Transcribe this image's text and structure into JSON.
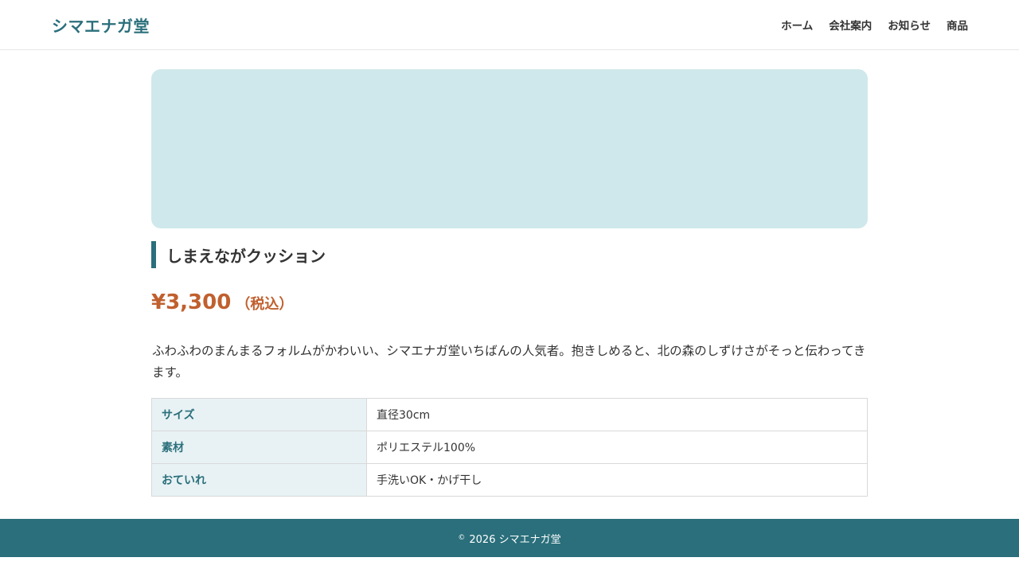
{
  "header": {
    "logo": "シマエナガ堂",
    "nav": [
      {
        "label": "ホーム"
      },
      {
        "label": "会社案内"
      },
      {
        "label": "お知らせ"
      },
      {
        "label": "商品"
      }
    ]
  },
  "product": {
    "name": "しまえながクッション",
    "price": "¥3,300",
    "tax_note": "（税込）",
    "description": "ふわふわのまんまるフォルムがかわいい、シマエナガ堂いちばんの人気者。抱きしめると、北の森のしずけさがそっと伝わってきます。",
    "specs": [
      {
        "label": "サイズ",
        "value": "直径30cm"
      },
      {
        "label": "素材",
        "value": "ポリエステル100%"
      },
      {
        "label": "おていれ",
        "value": "手洗いOK・かげ干し"
      }
    ]
  },
  "footer": {
    "copyright_symbol": "©",
    "text": "2026 シマエナガ堂"
  },
  "colors": {
    "brand": "#2a6f7b",
    "price": "#c0602e",
    "hero_bg": "#cfe8eb",
    "spec_label_bg": "#e8f2f4"
  }
}
